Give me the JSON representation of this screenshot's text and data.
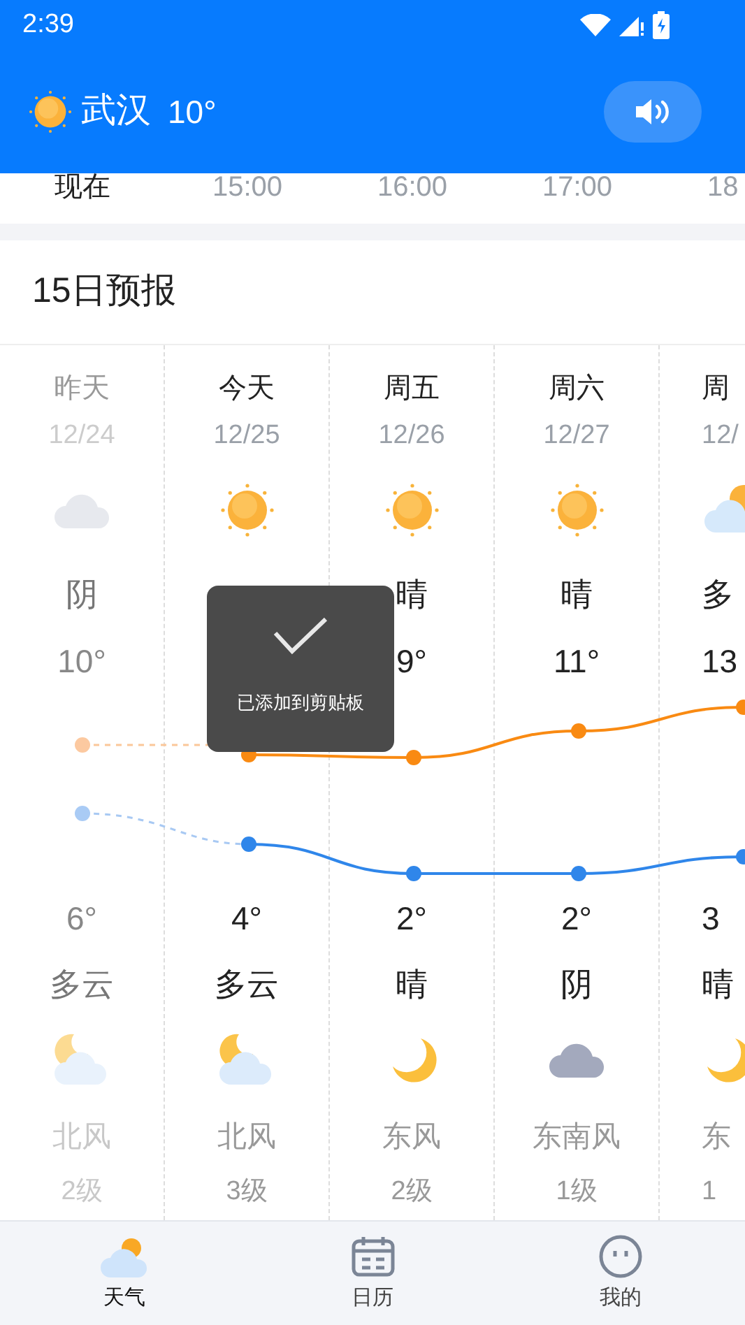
{
  "status_bar": {
    "time": "2:39"
  },
  "header": {
    "city": "武汉",
    "temp": "10°"
  },
  "hourly": [
    {
      "label": "现在",
      "current": true
    },
    {
      "label": "15:00",
      "current": false
    },
    {
      "label": "16:00",
      "current": false
    },
    {
      "label": "17:00",
      "current": false
    },
    {
      "label": "18",
      "current": false
    }
  ],
  "forecast": {
    "title": "15日预报",
    "days": [
      {
        "day": "昨天",
        "date": "12/24",
        "day_icon": {
          "kind": "cloud"
        },
        "day_weather": "阴",
        "high": "10°",
        "low": "6°",
        "night_weather": "多云",
        "night_icon": {
          "kind": "moon-cloud"
        },
        "wind": "北风",
        "wind_level": "2级",
        "past": true
      },
      {
        "day": "今天",
        "date": "12/25",
        "day_icon": {
          "kind": "sun"
        },
        "low": "4°",
        "night_weather": "多云",
        "night_icon": {
          "kind": "moon-cloud"
        },
        "wind": "北风",
        "wind_level": "3级",
        "past": false
      },
      {
        "day": "周五",
        "date": "12/26",
        "day_icon": {
          "kind": "sun"
        },
        "day_weather": "晴",
        "high": "9°",
        "low": "2°",
        "night_weather": "晴",
        "night_icon": {
          "kind": "moon"
        },
        "wind": "东风",
        "wind_level": "2级",
        "past": false
      },
      {
        "day": "周六",
        "date": "12/27",
        "day_icon": {
          "kind": "sun"
        },
        "day_weather": "晴",
        "high": "11°",
        "low": "2°",
        "night_weather": "阴",
        "night_icon": {
          "kind": "dark-cloud"
        },
        "wind": "东南风",
        "wind_level": "1级",
        "past": false
      },
      {
        "day": "周",
        "date": "12/",
        "day_icon": {
          "kind": "sun-cloud"
        },
        "day_weather": "多",
        "high": "13",
        "low": "3",
        "night_weather": "晴",
        "night_icon": {
          "kind": "moon"
        },
        "wind": "东",
        "wind_level": "1",
        "past": false
      }
    ]
  },
  "toast": {
    "text": "已添加到剪贴板"
  },
  "bottom_nav": [
    {
      "label": "天气",
      "kind": "weather",
      "selected": true
    },
    {
      "label": "日历",
      "kind": "calendar",
      "selected": false
    },
    {
      "label": "我的",
      "kind": "face",
      "selected": false
    }
  ]
}
